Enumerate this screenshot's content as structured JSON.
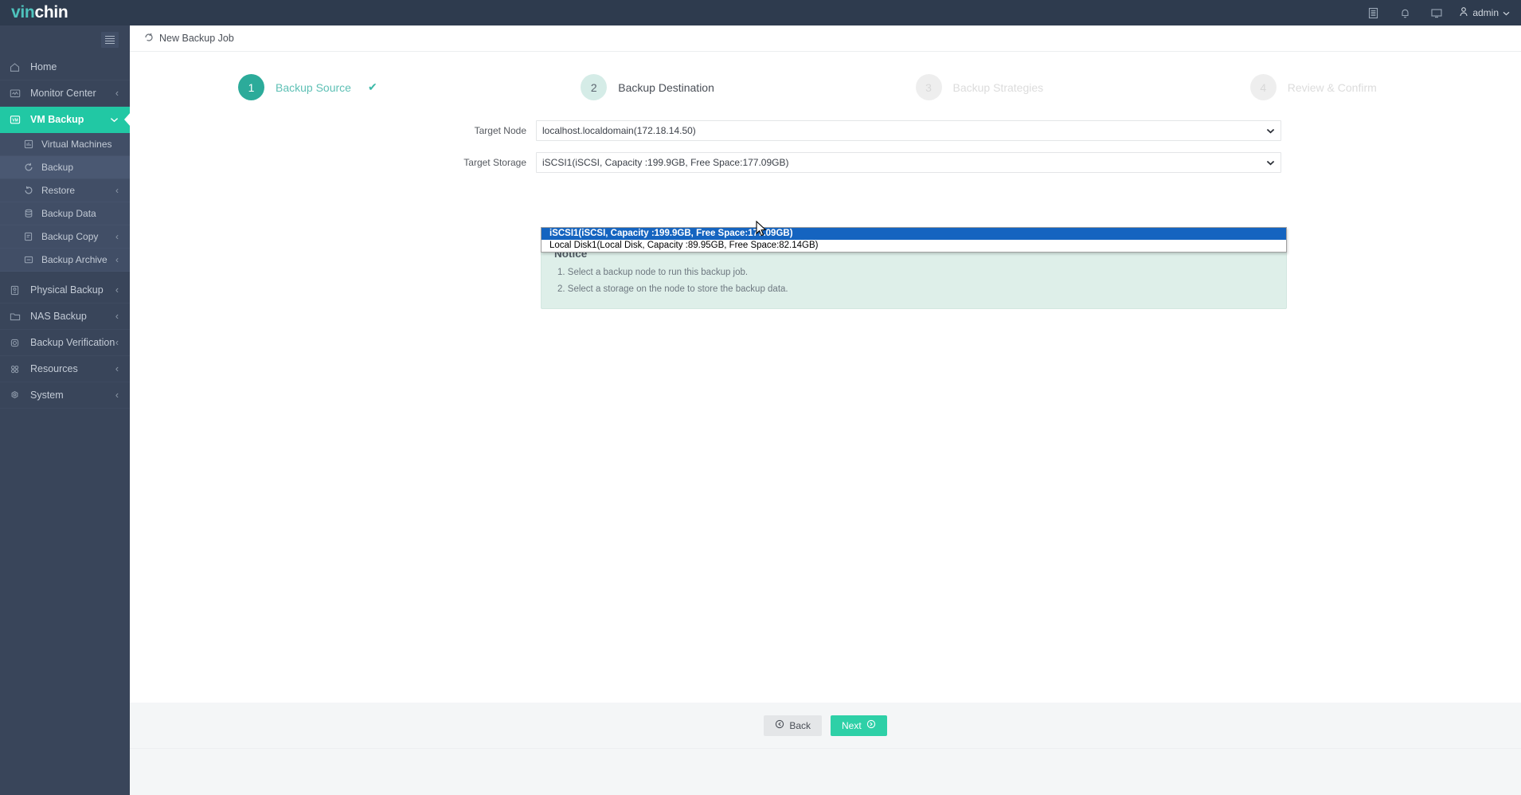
{
  "brand": {
    "name_part1": "vin",
    "name_part2": "chin",
    "accent": "#4ec3bd"
  },
  "header": {
    "icons": [
      {
        "name": "list-icon",
        "glyph": "list"
      },
      {
        "name": "bell-icon",
        "glyph": "bell"
      },
      {
        "name": "monitor-icon",
        "glyph": "monitor"
      }
    ],
    "user": {
      "label": "admin",
      "icon": "user-icon",
      "caret": "chevron-down-icon"
    }
  },
  "sidebar": {
    "collapse_icon": "hamburger-icon",
    "items": [
      {
        "label": "Home",
        "icon": "home-icon",
        "caret": "",
        "active": false,
        "level": 0
      },
      {
        "label": "Monitor Center",
        "icon": "monitor-center-icon",
        "caret": "‹",
        "active": false,
        "level": 0
      },
      {
        "label": "VM Backup",
        "icon": "vm-icon",
        "caret": "⌄",
        "active": true,
        "level": 0
      },
      {
        "label": "Virtual Machines",
        "icon": "virtual-machines-icon",
        "caret": "",
        "active": false,
        "level": 1
      },
      {
        "label": "Backup",
        "icon": "backup-icon",
        "caret": "",
        "active": true,
        "level": 1
      },
      {
        "label": "Restore",
        "icon": "restore-icon",
        "caret": "‹",
        "active": false,
        "level": 1
      },
      {
        "label": "Backup Data",
        "icon": "database-icon",
        "caret": "",
        "active": false,
        "level": 1
      },
      {
        "label": "Backup Copy",
        "icon": "copy-icon",
        "caret": "‹",
        "active": false,
        "level": 1
      },
      {
        "label": "Backup Archive",
        "icon": "archive-icon",
        "caret": "‹",
        "active": false,
        "level": 1
      },
      {
        "label": "Physical Backup",
        "icon": "server-icon",
        "caret": "‹",
        "active": false,
        "level": 0
      },
      {
        "label": "NAS Backup",
        "icon": "folder-icon",
        "caret": "‹",
        "active": false,
        "level": 0
      },
      {
        "label": "Backup Verification",
        "icon": "verification-icon",
        "caret": "‹",
        "active": false,
        "level": 0
      },
      {
        "label": "Resources",
        "icon": "resources-icon",
        "caret": "‹",
        "active": false,
        "level": 0
      },
      {
        "label": "System",
        "icon": "system-gear-icon",
        "caret": "‹",
        "active": false,
        "level": 0
      }
    ]
  },
  "page": {
    "title": "New Backup Job",
    "title_icon": "refresh-icon"
  },
  "stepper": {
    "steps": [
      {
        "num": "1",
        "label": "Backup Source",
        "state": "done",
        "check": "✔"
      },
      {
        "num": "2",
        "label": "Backup Destination",
        "state": "current",
        "check": ""
      },
      {
        "num": "3",
        "label": "Backup Strategies",
        "state": "todo",
        "check": ""
      },
      {
        "num": "4",
        "label": "Review & Confirm",
        "state": "todo",
        "check": ""
      }
    ]
  },
  "form": {
    "target_node": {
      "label": "Target Node",
      "value": "localhost.localdomain(172.18.14.50)",
      "options": [
        "localhost.localdomain(172.18.14.50)"
      ]
    },
    "target_storage": {
      "label": "Target Storage",
      "value": "iSCSI1(iSCSI, Capacity :199.9GB, Free Space:177.09GB)",
      "open": true,
      "options": [
        {
          "text": "iSCSI1(iSCSI, Capacity :199.9GB, Free Space:177.09GB)",
          "selected": true
        },
        {
          "text": "Local Disk1(Local Disk, Capacity :89.95GB, Free Space:82.14GB)",
          "selected": false
        }
      ]
    }
  },
  "notice": {
    "heading": "Notice",
    "lines": [
      "1. Select a backup node to run this backup job.",
      "2. Select a storage on the node to store the backup data."
    ],
    "background": "#deefe9"
  },
  "footer": {
    "back_label": "Back",
    "back_icon": "arrow-left-circle-icon",
    "next_label": "Next",
    "next_icon": "arrow-right-circle-icon",
    "next_color": "#2ed0a7"
  }
}
